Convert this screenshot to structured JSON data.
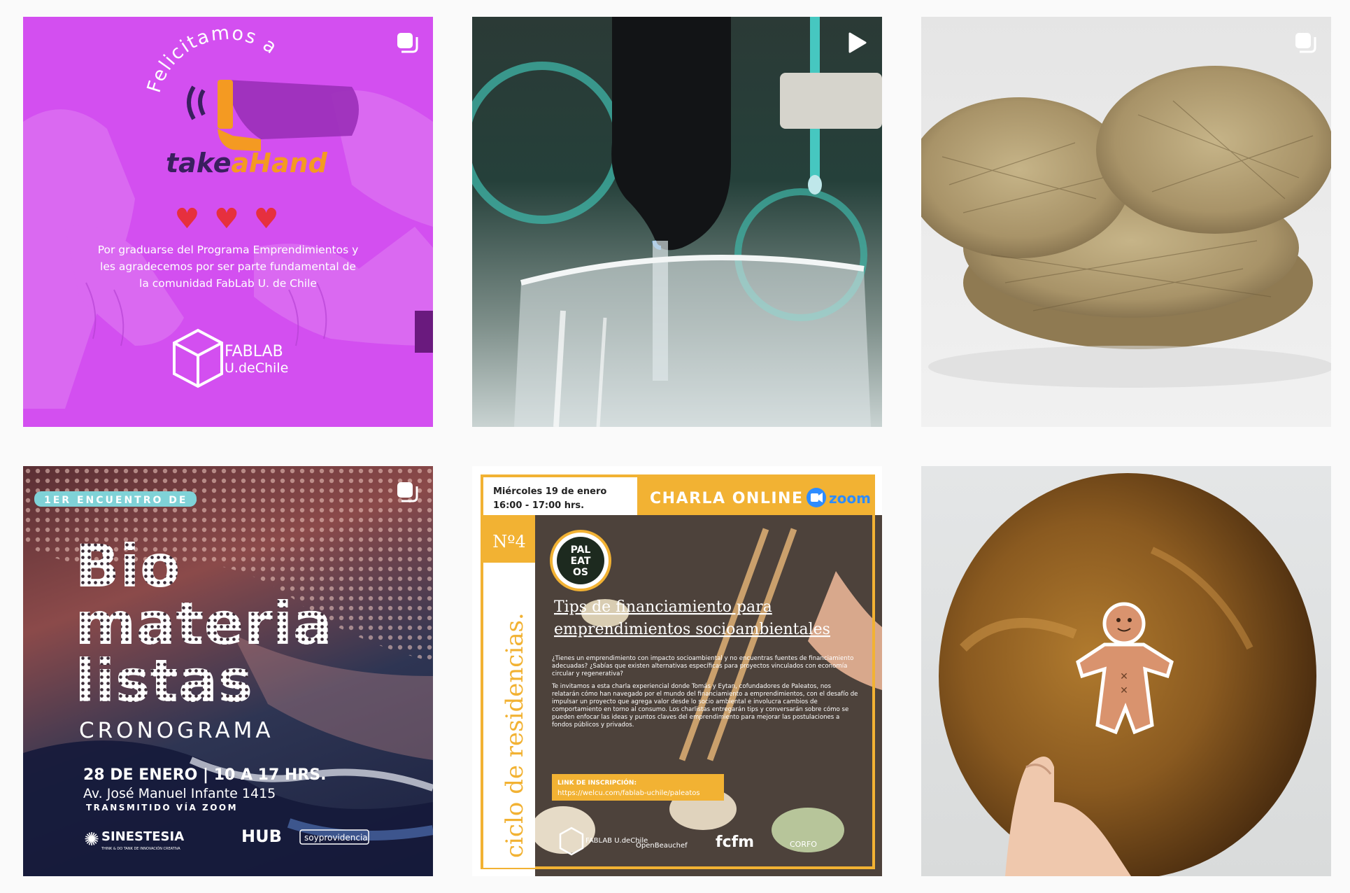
{
  "posts": [
    {
      "kind": "carousel",
      "badge_icon": "carousel-icon",
      "greeting": "Felicitamos a",
      "brand": {
        "take": "take",
        "a": "a",
        "hand": "Hand"
      },
      "hearts": "♥ ♥ ♥",
      "message_lines": [
        "Por graduarse del Programa Emprendimientos y",
        "les agradecemos por ser parte fundamental de",
        "la comunidad FabLab U. de Chile"
      ],
      "logo_line1": "FABLAB",
      "logo_line2": "U.deChile",
      "color": "#d34ff0"
    },
    {
      "kind": "video",
      "badge_icon": "play-icon"
    },
    {
      "kind": "carousel",
      "badge_icon": "carousel-icon"
    },
    {
      "kind": "carousel",
      "badge_icon": "carousel-icon",
      "event_tag": "1ER ENCUENTRO DE",
      "title_lines": [
        "Bio",
        "materia",
        "listas"
      ],
      "subtitle": "CRONOGRAMA",
      "date_line": "28 DE ENERO | 10 A 17 HRS.",
      "address": "Av. José Manuel Infante 1415",
      "stream": "TRANSMITIDO VÍA ZOOM",
      "sponsors": [
        "SINESTESIA",
        "HUB",
        "soyprovidencia"
      ],
      "sponsor_caption": "THINK & DO TANK DE INNOVACIÓN CREATIVA"
    },
    {
      "kind": "image",
      "date": "Miércoles 19 de enero",
      "time": "16:00 - 17:00 hrs.",
      "header": "CHARLA ONLINE",
      "zoom": "zoom",
      "number": "Nº4",
      "series": "ciclo de residencias.",
      "badge_text": [
        "PAL",
        "EAT",
        "OS"
      ],
      "title_line1": "Tips de financiamiento para",
      "title_line2": "emprendimientos socioambientales",
      "para1": "¿Tienes un emprendimiento con impacto socioambiental y no encuentras fuentes de financiamiento adecuadas? ¿Sabías que existen alternativas específicas para proyectos vinculados con economía circular y regenerativa?",
      "para2": "Te invitamos a esta charla experiencial donde Tomás y Eytan, cofundadores de Paleatos, nos relatarán cómo han navegado por el mundo del financiamiento a emprendimientos, con el desafío de impulsar un proyecto que agrega valor desde lo socio ambiental e involucra cambios de comportamiento en torno al consumo. Los charlistas entregarán tips y conversarán sobre cómo se pueden enfocar las ideas y puntos claves del emprendimiento para mejorar las postulaciones a fondos públicos y privados.",
      "link_label": "LINK DE INSCRIPCIÓN:",
      "link_url": "https://welcu.com/fablab-uchile/paleatos",
      "footer_logos": [
        "FABLAB U.deChile",
        "OpenBeauchef",
        "fcfm",
        "CORFO"
      ],
      "accent": "#f2b233"
    },
    {
      "kind": "image"
    }
  ]
}
